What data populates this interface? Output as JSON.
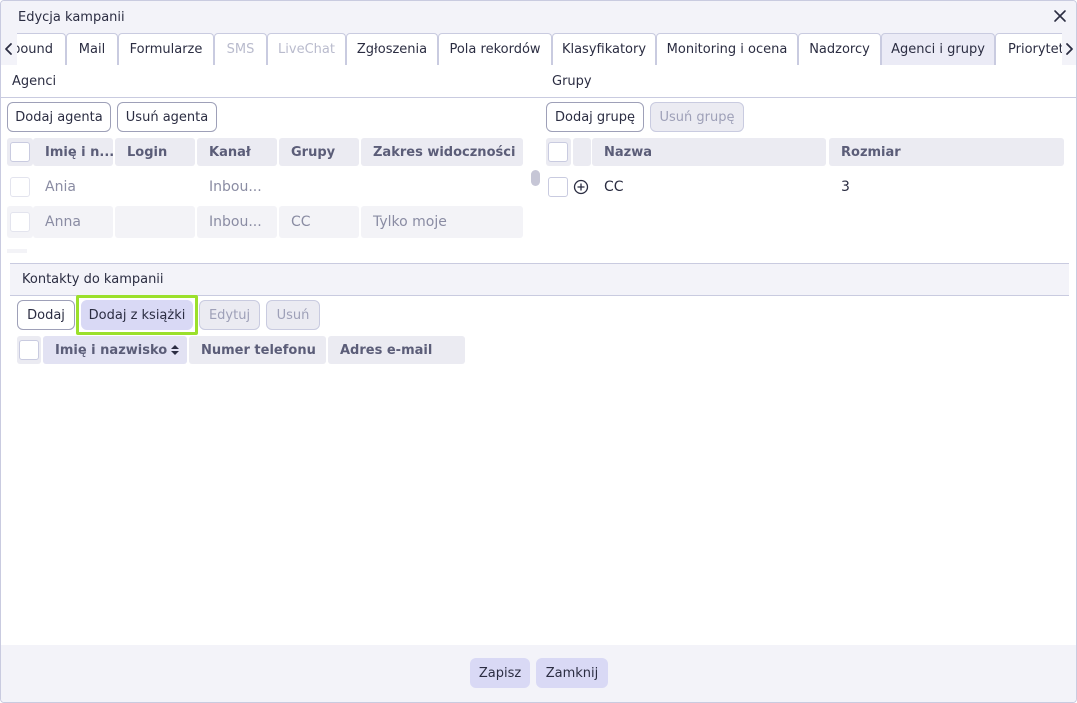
{
  "dialog": {
    "title": "Edycja kampanii"
  },
  "tabs": [
    {
      "label": "bound",
      "state": "normal"
    },
    {
      "label": "Mail",
      "state": "normal"
    },
    {
      "label": "Formularze",
      "state": "normal"
    },
    {
      "label": "SMS",
      "state": "disabled"
    },
    {
      "label": "LiveChat",
      "state": "disabled"
    },
    {
      "label": "Zgłoszenia",
      "state": "normal"
    },
    {
      "label": "Pola rekordów",
      "state": "normal"
    },
    {
      "label": "Klasyfikatory",
      "state": "normal"
    },
    {
      "label": "Monitoring i ocena",
      "state": "normal"
    },
    {
      "label": "Nadzorcy",
      "state": "normal"
    },
    {
      "label": "Agenci i grupy",
      "state": "active"
    },
    {
      "label": "Priorytety",
      "state": "normal"
    }
  ],
  "agents": {
    "header": "Agenci",
    "add_label": "Dodaj agenta",
    "remove_label": "Usuń agenta",
    "columns": [
      "Imię i n...",
      "Login",
      "Kanał",
      "Grupy",
      "Zakres widoczności"
    ],
    "rows": [
      {
        "name": "Ania",
        "login": "",
        "channel": "Inbou...",
        "groups": "",
        "scope": ""
      },
      {
        "name": "Anna",
        "login": "",
        "channel": "Inbou...",
        "groups": "CC",
        "scope": "Tylko moje"
      }
    ]
  },
  "groups": {
    "header": "Grupy",
    "add_label": "Dodaj grupę",
    "remove_label": "Usuń grupę",
    "columns": [
      "Nazwa",
      "Rozmiar"
    ],
    "rows": [
      {
        "name": "CC",
        "size": "3"
      }
    ]
  },
  "contacts": {
    "header": "Kontakty do kampanii",
    "add_label": "Dodaj",
    "add_from_book_label": "Dodaj z książki",
    "edit_label": "Edytuj",
    "remove_label": "Usuń",
    "columns": [
      "Imię i nazwisko",
      "Numer telefonu",
      "Adres e-mail"
    ]
  },
  "footer": {
    "save_label": "Zapisz",
    "close_label": "Zamknij"
  },
  "colors": {
    "accent_soft": "#d9d9f5",
    "highlight": "#9be02b",
    "header_bg": "#ebebf2"
  }
}
